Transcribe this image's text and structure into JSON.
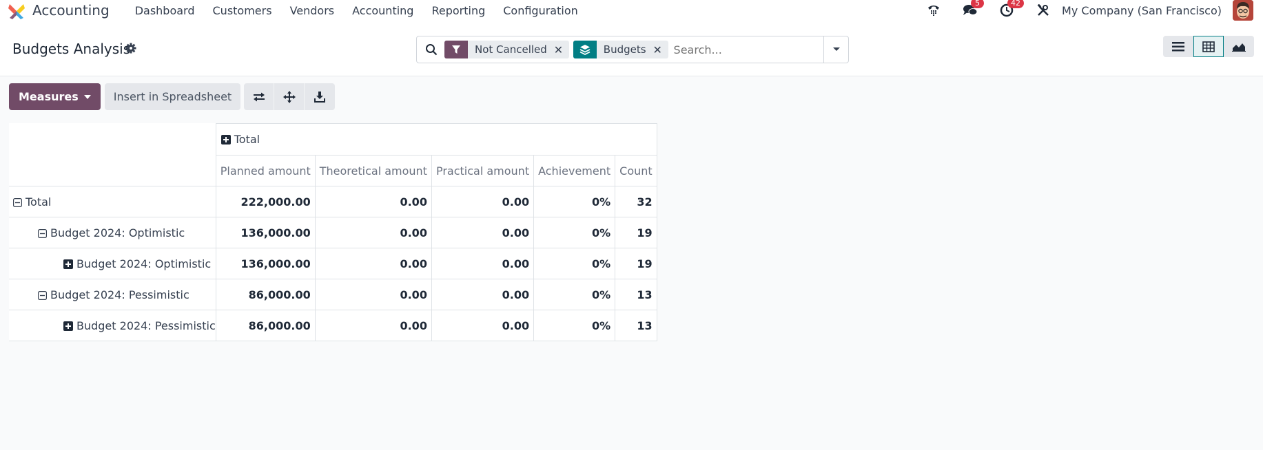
{
  "navbar": {
    "app_name": "Accounting",
    "menu": [
      "Dashboard",
      "Customers",
      "Vendors",
      "Accounting",
      "Reporting",
      "Configuration"
    ],
    "messages_count": "5",
    "activities_count": "42",
    "company": "My Company (San Francisco)"
  },
  "control": {
    "title": "Budgets Analysis",
    "facets": [
      {
        "icon": "filter-icon",
        "label": "Not Cancelled"
      },
      {
        "icon": "layers-icon",
        "label": "Budgets"
      }
    ],
    "search_placeholder": "Search...",
    "views": [
      "list-view",
      "pivot-view",
      "graph-view"
    ],
    "active_view": "pivot-view"
  },
  "toolbar": {
    "measures_label": "Measures",
    "insert_label": "Insert in Spreadsheet"
  },
  "pivot": {
    "column_group": "Total",
    "measures": [
      "Planned amount",
      "Theoretical amount",
      "Practical amount",
      "Achievement",
      "Count"
    ],
    "rows": [
      {
        "label": "Total",
        "level": 0,
        "expand": "minus",
        "values": [
          "222,000.00",
          "0.00",
          "0.00",
          "0%",
          "32"
        ]
      },
      {
        "label": "Budget 2024: Optimistic",
        "level": 1,
        "expand": "minus",
        "values": [
          "136,000.00",
          "0.00",
          "0.00",
          "0%",
          "19"
        ]
      },
      {
        "label": "Budget 2024: Optimistic",
        "level": 2,
        "expand": "plus",
        "values": [
          "136,000.00",
          "0.00",
          "0.00",
          "0%",
          "19"
        ]
      },
      {
        "label": "Budget 2024: Pessimistic",
        "level": 1,
        "expand": "minus",
        "values": [
          "86,000.00",
          "0.00",
          "0.00",
          "0%",
          "13"
        ]
      },
      {
        "label": "Budget 2024: Pessimistic",
        "level": 2,
        "expand": "plus",
        "values": [
          "86,000.00",
          "0.00",
          "0.00",
          "0%",
          "13"
        ]
      }
    ]
  },
  "colors": {
    "primary": "#714b67",
    "secondary": "#017e84",
    "badge": "#dc3545"
  }
}
